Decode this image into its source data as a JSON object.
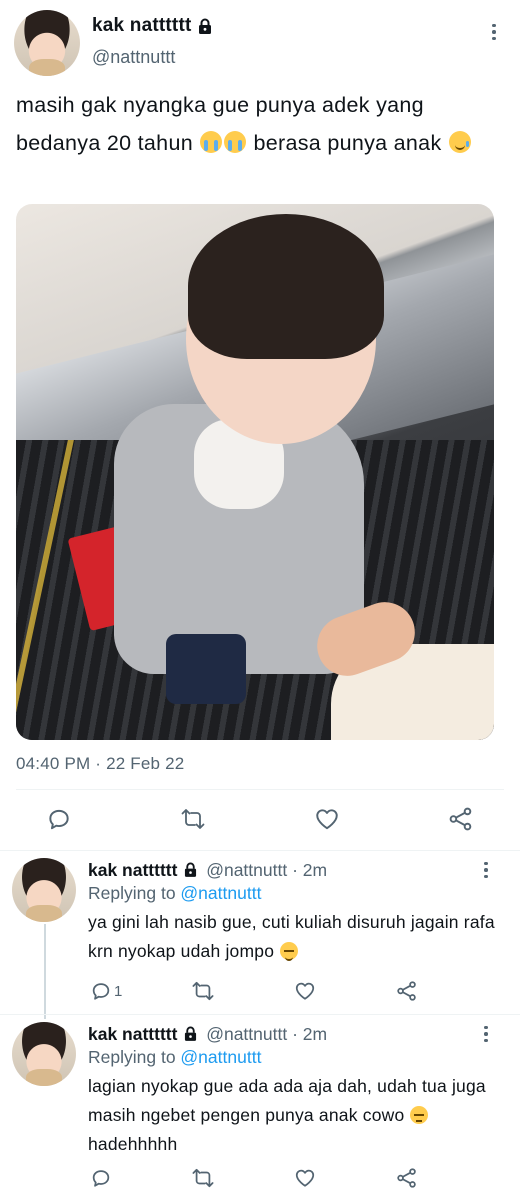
{
  "main_tweet": {
    "display_name": "kak natttttt",
    "handle": "@nattnuttt",
    "text_parts": [
      "masih gak nyangka gue punya adek yang bedanya 20 tahun ",
      " berasa punya anak "
    ],
    "emojis": [
      "loudly-crying-face",
      "loudly-crying-face",
      "face-holding-back-tears"
    ],
    "timestamp": "04:40 PM · 22 Feb 22",
    "photo_description_icon": "photo"
  },
  "replies": [
    {
      "display_name": "kak natttttt",
      "meta": "@nattnuttt · 2m",
      "replying_prefix": "Replying to ",
      "replying_to": "@nattnuttt",
      "text": "ya gini lah nasib gue, cuti kuliah disuruh jagain rafa krn nyokap udah jompo ",
      "emoji": "relieved-face",
      "reply_count": "1"
    },
    {
      "display_name": "kak natttttt",
      "meta": "@nattnuttt · 2m",
      "replying_prefix": "Replying to ",
      "replying_to": "@nattnuttt",
      "text_before": "lagian nyokap gue ada ada aja dah, udah tua juga masih ngebet pengen punya anak cowo ",
      "text_after": " hadehhhhh",
      "emoji": "expressionless-face",
      "reply_count": ""
    }
  ],
  "colors": {
    "text": "#0f1419",
    "secondary": "#536471",
    "link": "#1d9bf0",
    "divider": "#eff3f4"
  },
  "icons": [
    "lock-icon",
    "more-icon",
    "reply-icon",
    "retweet-icon",
    "like-icon",
    "share-icon"
  ]
}
